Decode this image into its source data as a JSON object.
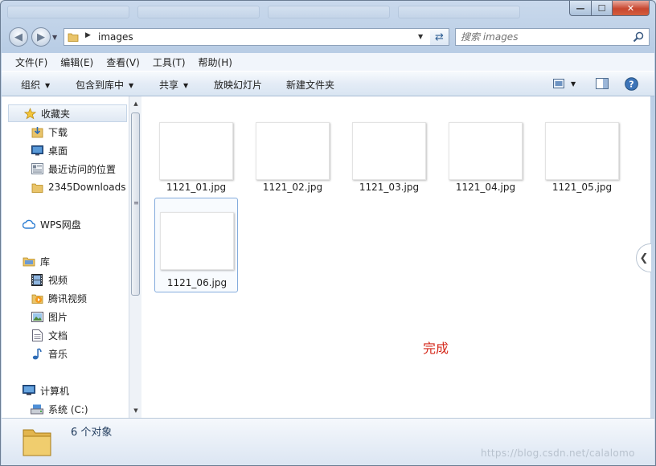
{
  "window": {
    "controls": {
      "minimize": "—",
      "maximize": "☐",
      "close": "✕"
    }
  },
  "address": {
    "path": "images",
    "search_placeholder": "搜索 images"
  },
  "menubar": [
    "文件(F)",
    "编辑(E)",
    "查看(V)",
    "工具(T)",
    "帮助(H)"
  ],
  "toolbar": {
    "organize": "组织",
    "include_library": "包含到库中",
    "share": "共享",
    "slideshow": "放映幻灯片",
    "new_folder": "新建文件夹"
  },
  "sidebar": {
    "favorites": {
      "label": "收藏夹",
      "items": [
        "下载",
        "桌面",
        "最近访问的位置",
        "2345Downloads"
      ]
    },
    "wps": "WPS网盘",
    "libraries": {
      "label": "库",
      "items": [
        "视频",
        "腾讯视频",
        "图片",
        "文档",
        "音乐"
      ]
    },
    "computer": {
      "label": "计算机",
      "items": [
        "系统 (C:)"
      ]
    }
  },
  "files": [
    {
      "name": "1121_01.jpg",
      "selected": false
    },
    {
      "name": "1121_02.jpg",
      "selected": false
    },
    {
      "name": "1121_03.jpg",
      "selected": false
    },
    {
      "name": "1121_04.jpg",
      "selected": false
    },
    {
      "name": "1121_05.jpg",
      "selected": false
    },
    {
      "name": "1121_06.jpg",
      "selected": true
    }
  ],
  "overlay_text": "完成",
  "status": {
    "count_text": "6 个对象"
  },
  "watermark": "https://blog.csdn.net/calalomo",
  "colors": {
    "selection_border": "#84acdd",
    "done_text": "#d52a1c",
    "status_text": "#1e395b"
  }
}
